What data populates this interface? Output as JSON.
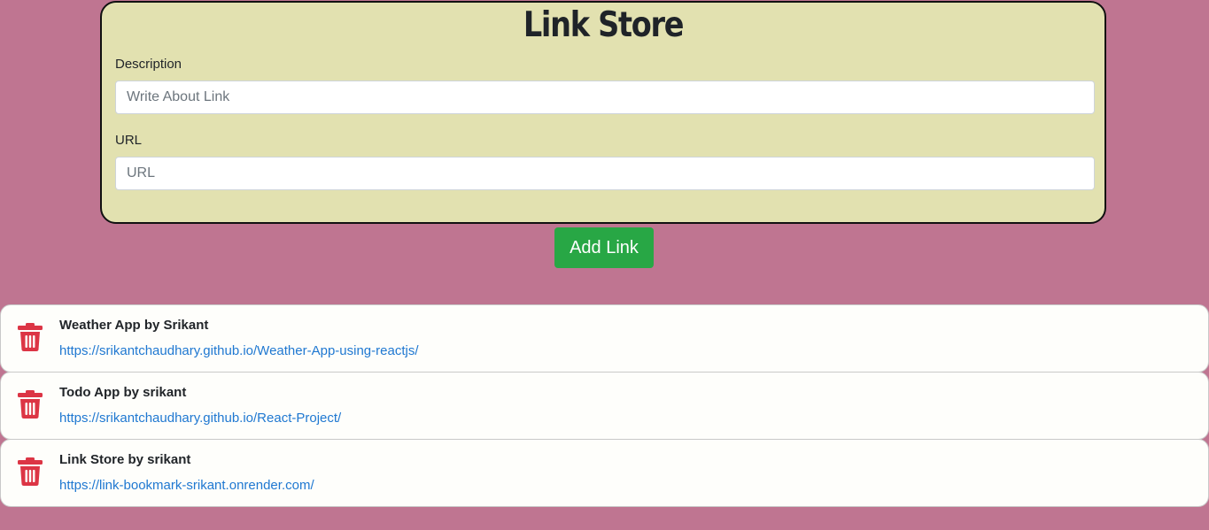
{
  "app": {
    "title": "Link Store"
  },
  "form": {
    "description_label": "Description",
    "description_placeholder": "Write About Link",
    "description_value": "",
    "url_label": "URL",
    "url_placeholder": "URL",
    "url_value": ""
  },
  "actions": {
    "add_label": "Add Link"
  },
  "links": [
    {
      "title": "Weather App by Srikant",
      "url": "https://srikantchaudhary.github.io/Weather-App-using-reactjs/"
    },
    {
      "title": "Todo App by srikant",
      "url": "https://srikantchaudhary.github.io/React-Project/"
    },
    {
      "title": "Link Store by srikant",
      "url": "https://link-bookmark-srikant.onrender.com/"
    }
  ],
  "icons": {
    "delete": "trash-icon"
  },
  "colors": {
    "page_background": "#bf7591",
    "form_background": "#e2e1b0",
    "add_button": "#28a745",
    "delete_icon": "#dc3545",
    "link_text": "#1f78d1"
  }
}
